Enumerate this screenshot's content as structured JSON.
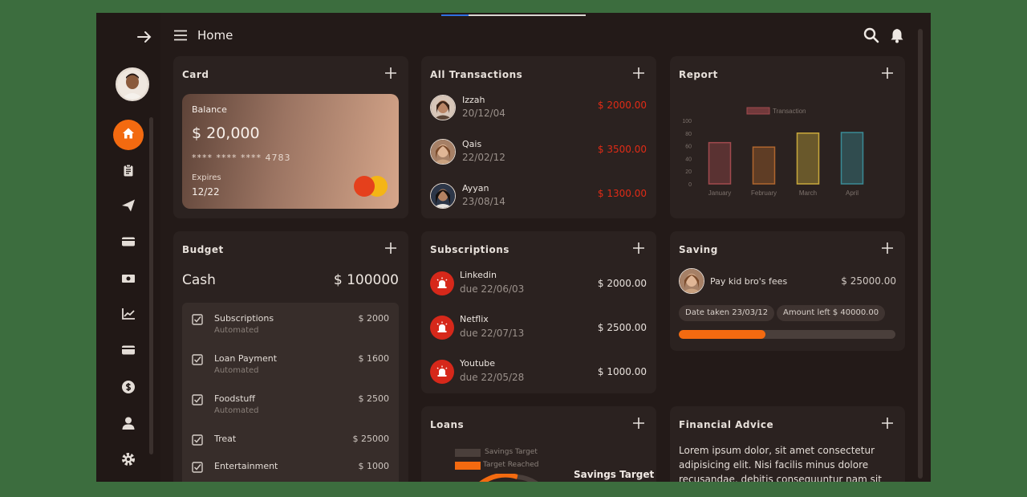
{
  "header": {
    "title": "Home"
  },
  "card": {
    "title": "Card",
    "balance_label": "Balance",
    "balance": "$ 20,000",
    "number": "**** **** **** 4783",
    "expires_label": "Expires",
    "expires": "12/22"
  },
  "transactions": {
    "title": "All Transactions",
    "items": [
      {
        "name": "Izzah",
        "date": "20/12/04",
        "amount": "$ 2000.00"
      },
      {
        "name": "Qais",
        "date": "22/02/12",
        "amount": "$ 3500.00"
      },
      {
        "name": "Ayyan",
        "date": "23/08/14",
        "amount": "$ 1300.00"
      }
    ]
  },
  "report": {
    "title": "Report",
    "chart_data": {
      "type": "bar",
      "categories": [
        "January",
        "February",
        "March",
        "April"
      ],
      "series": [
        {
          "name": "Transaction",
          "values": [
            65,
            58,
            80,
            81
          ]
        }
      ],
      "ylim": [
        0,
        100
      ],
      "yticks": [
        "100",
        "80",
        "60",
        "40",
        "20",
        "0"
      ],
      "colors": [
        "#a24a4e",
        "#b0662e",
        "#c9a93c",
        "#3a8b96"
      ],
      "legend": "top"
    }
  },
  "budget": {
    "title": "Budget",
    "label": "Cash",
    "total": "$ 100000",
    "items": [
      {
        "name": "Subscriptions",
        "sub": "Automated",
        "amount": "$ 2000"
      },
      {
        "name": "Loan Payment",
        "sub": "Automated",
        "amount": "$ 1600"
      },
      {
        "name": "Foodstuff",
        "sub": "Automated",
        "amount": "$ 2500"
      },
      {
        "name": "Treat",
        "sub": "",
        "amount": "$ 25000"
      },
      {
        "name": "Entertainment",
        "sub": "",
        "amount": "$ 1000"
      }
    ]
  },
  "subscriptions": {
    "title": "Subscriptions",
    "items": [
      {
        "name": "Linkedin",
        "due": "due 22/06/03",
        "amount": "$ 2000.00"
      },
      {
        "name": "Netflix",
        "due": "due 22/07/13",
        "amount": "$ 2500.00"
      },
      {
        "name": "Youtube",
        "due": "due 22/05/28",
        "amount": "$ 1000.00"
      }
    ]
  },
  "saving": {
    "title": "Saving",
    "goal": "Pay kid bro's fees",
    "amount": "$ 25000.00",
    "date_taken": "Date taken 23/03/12",
    "amount_left": "Amount left $ 40000.00",
    "progress": 0.4
  },
  "loans": {
    "title": "Loans",
    "legend": [
      "Savings Target",
      "Target Reached"
    ],
    "chart_label": "Savings Target"
  },
  "advice": {
    "title": "Financial Advice",
    "text": "Lorem ipsum dolor, sit amet consectetur adipisicing elit. Nisi facilis minus dolore recusandae, debitis consequuntur nam sit iusto"
  }
}
